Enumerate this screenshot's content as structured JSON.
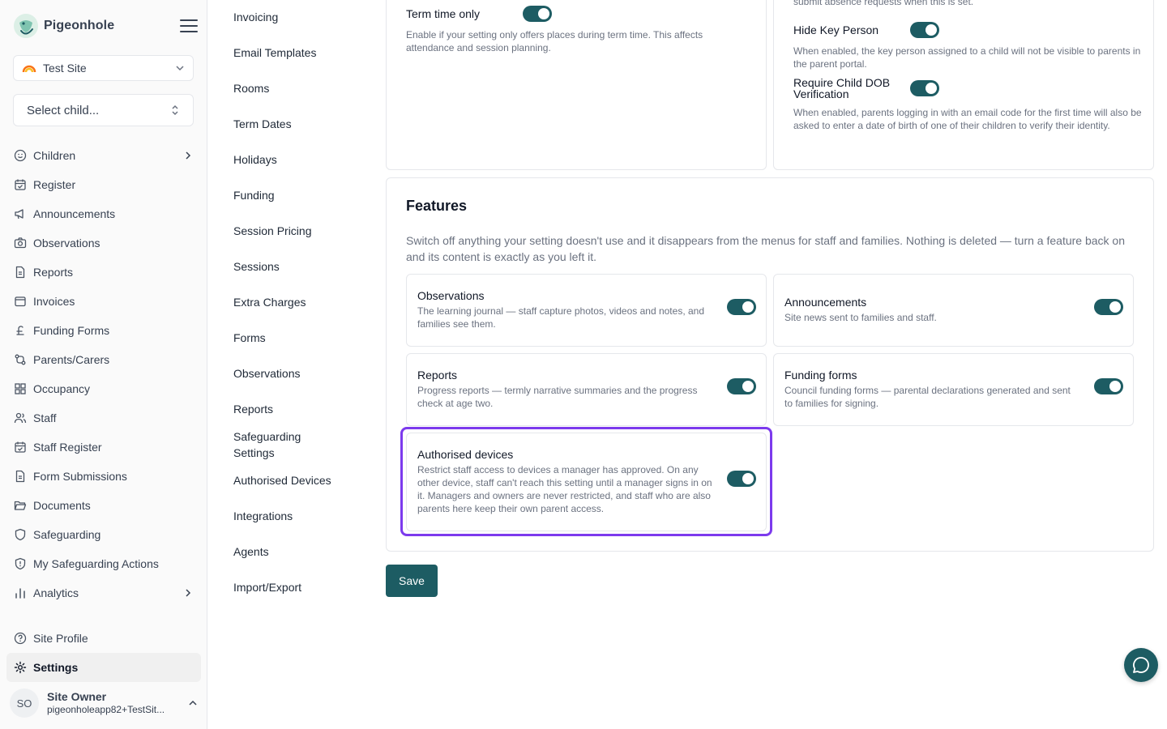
{
  "brand": {
    "name": "Pigeonhole"
  },
  "site_select": {
    "value": "Test Site"
  },
  "child_select": {
    "placeholder": "Select child..."
  },
  "nav": {
    "items": [
      {
        "label": "Children"
      },
      {
        "label": "Register"
      },
      {
        "label": "Announcements"
      },
      {
        "label": "Observations"
      },
      {
        "label": "Reports"
      },
      {
        "label": "Invoices"
      },
      {
        "label": "Funding Forms"
      },
      {
        "label": "Parents/Carers"
      },
      {
        "label": "Occupancy"
      },
      {
        "label": "Staff"
      },
      {
        "label": "Staff Register"
      },
      {
        "label": "Form Submissions"
      },
      {
        "label": "Documents"
      },
      {
        "label": "Safeguarding"
      },
      {
        "label": "My Safeguarding Actions"
      },
      {
        "label": "Analytics"
      }
    ],
    "bottom": [
      {
        "label": "Site Profile"
      },
      {
        "label": "Settings"
      }
    ]
  },
  "user": {
    "initials": "SO",
    "name": "Site Owner",
    "email": "pigeonholeapp82+TestSit..."
  },
  "settings_nav": {
    "items": [
      "Invoicing",
      "Email Templates",
      "Rooms",
      "Term Dates",
      "Holidays",
      "Funding",
      "Session Pricing",
      "Sessions",
      "Extra Charges",
      "Forms",
      "Observations",
      "Reports",
      "Safeguarding Settings",
      "Authorised Devices",
      "Integrations",
      "Agents",
      "Import/Export"
    ]
  },
  "term_time": {
    "label": "Term time only",
    "desc": "Enable if your setting only offers places during term time. This affects attendance and session planning.",
    "enabled": true
  },
  "right_card": {
    "cut_text": "submit absence requests when this is set.",
    "hide_key_person": {
      "label": "Hide Key Person",
      "desc": "When enabled, the key person assigned to a child will not be visible to parents in the parent portal.",
      "enabled": true
    },
    "require_dob": {
      "label": "Require Child DOB Verification",
      "desc": "When enabled, parents logging in with an email code for the first time will also be asked to enter a date of birth of one of their children to verify their identity.",
      "enabled": true
    }
  },
  "features": {
    "title": "Features",
    "desc": "Switch off anything your setting doesn't use and it disappears from the menus for staff and families. Nothing is deleted — turn a feature back on and its content is exactly as you left it.",
    "observations": {
      "title": "Observations",
      "desc": "The learning journal — staff capture photos, videos and notes, and families see them.",
      "enabled": true
    },
    "announcements": {
      "title": "Announcements",
      "desc": "Site news sent to families and staff.",
      "enabled": true
    },
    "reports": {
      "title": "Reports",
      "desc": "Progress reports — termly narrative summaries and the progress check at age two.",
      "enabled": true
    },
    "funding_forms": {
      "title": "Funding forms",
      "desc": "Council funding forms — parental declarations generated and sent to families for signing.",
      "enabled": true
    },
    "authorised_devices": {
      "title": "Authorised devices",
      "desc": "Restrict staff access to devices a manager has approved. On any other device, staff can't reach this setting until a manager signs in on it. Managers and owners are never restricted, and staff who are also parents here keep their own parent access.",
      "enabled": true
    }
  },
  "save_label": "Save",
  "colors": {
    "accent": "#1d5c63",
    "highlight": "#7c3aed"
  }
}
